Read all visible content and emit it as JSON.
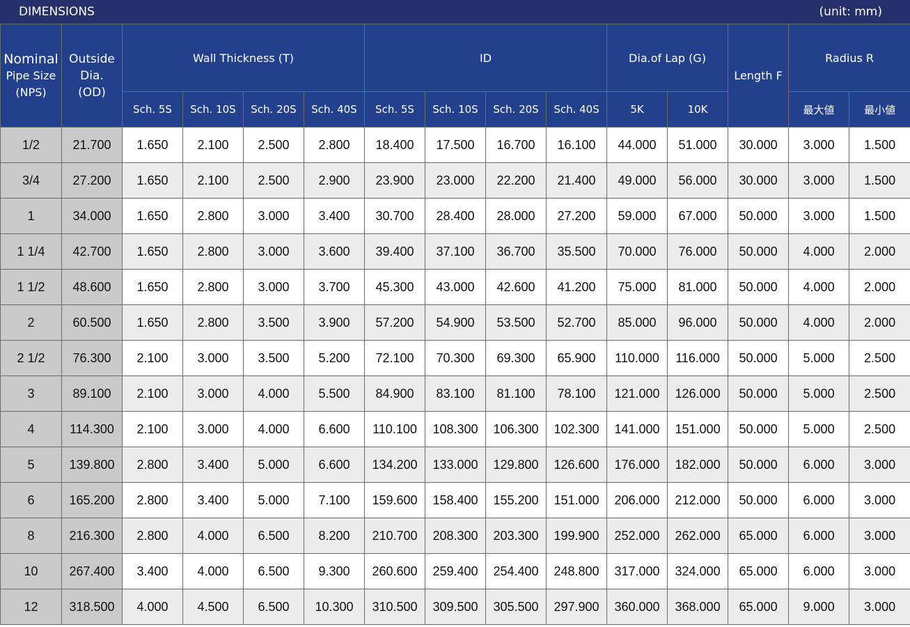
{
  "title": "DIMENSIONS",
  "unit": "(unit: mm)",
  "colors": {
    "title_bar": "#25306a",
    "header": "#23408c",
    "key_column": "#cacaca",
    "stripe": "#ececec"
  },
  "headers": {
    "nps": [
      "Nominal",
      "Pipe Size",
      "(NPS)"
    ],
    "od": [
      "Outside",
      "Dia.",
      "(OD)"
    ],
    "wall": "Wall Thickness (T)",
    "id": "ID",
    "lap": "Dia.of Lap (G)",
    "length": "Length F",
    "radius": "Radius R",
    "wall_sub": [
      "Sch. 5S",
      "Sch. 10S",
      "Sch. 20S",
      "Sch. 40S"
    ],
    "id_sub": [
      "Sch. 5S",
      "Sch. 10S",
      "Sch. 20S",
      "Sch. 40S"
    ],
    "lap_sub": [
      "5K",
      "10K"
    ],
    "radius_sub": [
      "最大値",
      "最小値"
    ]
  },
  "rows": [
    [
      "1/2",
      "21.700",
      "1.650",
      "2.100",
      "2.500",
      "2.800",
      "18.400",
      "17.500",
      "16.700",
      "16.100",
      "44.000",
      "51.000",
      "30.000",
      "3.000",
      "1.500"
    ],
    [
      "3/4",
      "27.200",
      "1.650",
      "2.100",
      "2.500",
      "2.900",
      "23.900",
      "23.000",
      "22.200",
      "21.400",
      "49.000",
      "56.000",
      "30.000",
      "3.000",
      "1.500"
    ],
    [
      "1",
      "34.000",
      "1.650",
      "2.800",
      "3.000",
      "3.400",
      "30.700",
      "28.400",
      "28.000",
      "27.200",
      "59.000",
      "67.000",
      "50.000",
      "3.000",
      "1.500"
    ],
    [
      "1 1/4",
      "42.700",
      "1.650",
      "2.800",
      "3.000",
      "3.600",
      "39.400",
      "37.100",
      "36.700",
      "35.500",
      "70.000",
      "76.000",
      "50.000",
      "4.000",
      "2.000"
    ],
    [
      "1 1/2",
      "48.600",
      "1.650",
      "2.800",
      "3.000",
      "3.700",
      "45.300",
      "43.000",
      "42.600",
      "41.200",
      "75.000",
      "81.000",
      "50.000",
      "4.000",
      "2.000"
    ],
    [
      "2",
      "60.500",
      "1.650",
      "2.800",
      "3.500",
      "3.900",
      "57.200",
      "54.900",
      "53.500",
      "52.700",
      "85.000",
      "96.000",
      "50.000",
      "4.000",
      "2.000"
    ],
    [
      "2 1/2",
      "76.300",
      "2.100",
      "3.000",
      "3.500",
      "5.200",
      "72.100",
      "70.300",
      "69.300",
      "65.900",
      "110.000",
      "116.000",
      "50.000",
      "5.000",
      "2.500"
    ],
    [
      "3",
      "89.100",
      "2.100",
      "3.000",
      "4.000",
      "5.500",
      "84.900",
      "83.100",
      "81.100",
      "78.100",
      "121.000",
      "126.000",
      "50.000",
      "5.000",
      "2.500"
    ],
    [
      "4",
      "114.300",
      "2.100",
      "3.000",
      "4.000",
      "6.600",
      "110.100",
      "108.300",
      "106.300",
      "102.300",
      "141.000",
      "151.000",
      "50.000",
      "5.000",
      "2.500"
    ],
    [
      "5",
      "139.800",
      "2.800",
      "3.400",
      "5.000",
      "6.600",
      "134.200",
      "133.000",
      "129.800",
      "126.600",
      "176.000",
      "182.000",
      "50.000",
      "6.000",
      "3.000"
    ],
    [
      "6",
      "165.200",
      "2.800",
      "3.400",
      "5.000",
      "7.100",
      "159.600",
      "158.400",
      "155.200",
      "151.000",
      "206.000",
      "212.000",
      "50.000",
      "6.000",
      "3.000"
    ],
    [
      "8",
      "216.300",
      "2.800",
      "4.000",
      "6.500",
      "8.200",
      "210.700",
      "208.300",
      "203.300",
      "199.900",
      "252.000",
      "262.000",
      "65.000",
      "6.000",
      "3.000"
    ],
    [
      "10",
      "267.400",
      "3.400",
      "4.000",
      "6.500",
      "9.300",
      "260.600",
      "259.400",
      "254.400",
      "248.800",
      "317.000",
      "324.000",
      "65.000",
      "6.000",
      "3.000"
    ],
    [
      "12",
      "318.500",
      "4.000",
      "4.500",
      "6.500",
      "10.300",
      "310.500",
      "309.500",
      "305.500",
      "297.900",
      "360.000",
      "368.000",
      "65.000",
      "9.000",
      "3.000"
    ]
  ]
}
